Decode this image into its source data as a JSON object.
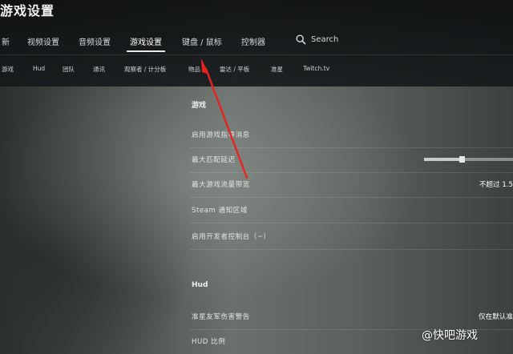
{
  "window": {
    "title": "游戏设置"
  },
  "tabs": [
    {
      "label": "新"
    },
    {
      "label": "视频设置"
    },
    {
      "label": "音频设置"
    },
    {
      "label": "游戏设置"
    },
    {
      "label": "键盘 / 鼠标"
    },
    {
      "label": "控制器"
    }
  ],
  "active_tab": "游戏设置",
  "search": {
    "label": "Search",
    "icon": "search-icon"
  },
  "subtabs": [
    {
      "label": "游戏"
    },
    {
      "label": "Hud"
    },
    {
      "label": "团队"
    },
    {
      "label": "通讯"
    },
    {
      "label": "观察者 / 计分板"
    },
    {
      "label": "物品"
    },
    {
      "label": "雷达 / 平板"
    },
    {
      "label": "准星"
    },
    {
      "label": "Twitch.tv"
    }
  ],
  "sections": {
    "game": {
      "title": "游戏",
      "rows": [
        {
          "label": "启用游戏指导消息"
        },
        {
          "label": "最大匹配延迟",
          "slider_value": 0.42
        },
        {
          "label": "最大游戏流量带宽",
          "value": "不超过 1.5"
        },
        {
          "label": "Steam 通知区域"
        },
        {
          "label": "启用开发者控制台（~）"
        }
      ]
    },
    "hud": {
      "title": "Hud",
      "rows": [
        {
          "label": "准星友军伤害警告",
          "value": "仅在默认准"
        },
        {
          "label": "HUD 比例"
        }
      ]
    }
  },
  "annotation": {
    "color": "#e8231f"
  },
  "watermark": {
    "text": "@快吧游戏"
  },
  "colors": {
    "accent": "#ffffff",
    "arrow": "#e8231f"
  }
}
